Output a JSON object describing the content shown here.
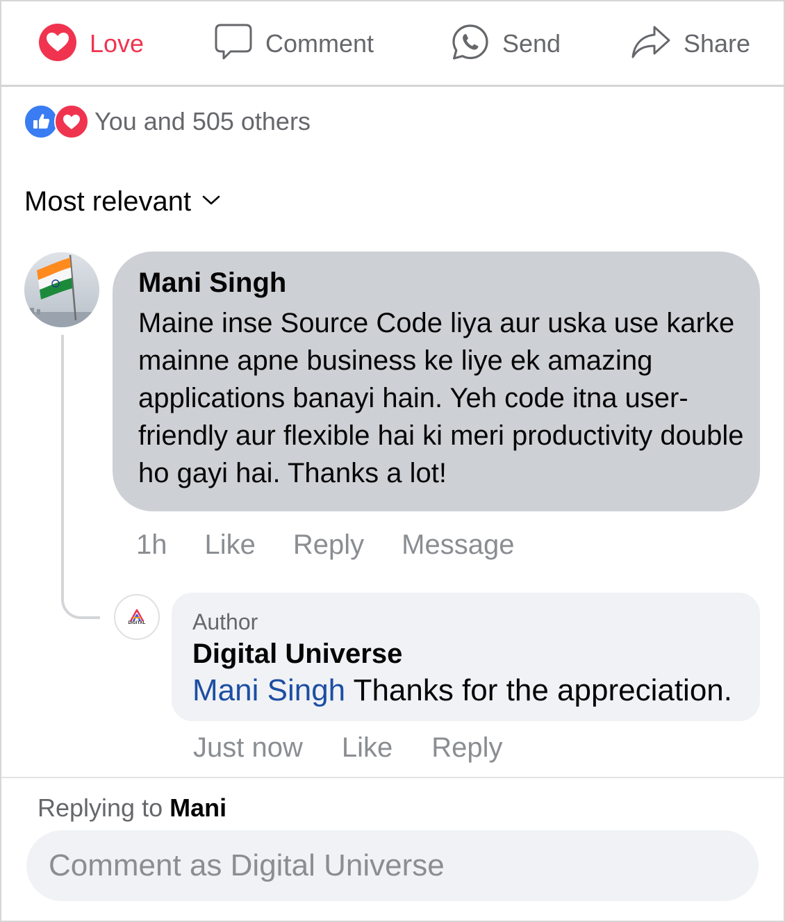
{
  "action_bar": {
    "love": {
      "label": "Love",
      "icon": "heart-icon",
      "color": "#f0344f"
    },
    "comment": {
      "label": "Comment",
      "icon": "speech-bubble-icon"
    },
    "send": {
      "label": "Send",
      "icon": "whatsapp-icon"
    },
    "share": {
      "label": "Share",
      "icon": "share-arrow-icon"
    }
  },
  "reactions": {
    "icons": [
      "thumbs-up-icon",
      "heart-icon"
    ],
    "summary": "You and 505 others"
  },
  "sort": {
    "label": "Most relevant",
    "icon": "chevron-down-icon"
  },
  "comments": [
    {
      "author": "Mani Singh",
      "avatar": "indian-flag-avatar",
      "text": "Maine inse Source Code liya aur uska use karke mainne apne business ke liye ek amazing applications banayi hain. Yeh code itna user-friendly aur flexible hai ki meri productivity double ho gayi hai. Thanks a lot!",
      "time": "1h",
      "actions": {
        "like": "Like",
        "reply": "Reply",
        "message": "Message"
      }
    }
  ],
  "reply": {
    "badge": "Author",
    "author": "Digital Universe",
    "avatar_text": "DIGITAL",
    "mention": "Mani Singh",
    "text": " Thanks for the appreciation.",
    "time": "Just now",
    "actions": {
      "like": "Like",
      "reply": "Reply"
    }
  },
  "composer": {
    "replying_prefix": "Replying to ",
    "replying_name": "Mani",
    "placeholder": "Comment as Digital Universe"
  },
  "colors": {
    "love": "#f0344f",
    "like": "#3a7cf2",
    "mention": "#1d4ea3",
    "bubble": "#cdd0d5",
    "reply_bubble": "#f0f2f5"
  }
}
